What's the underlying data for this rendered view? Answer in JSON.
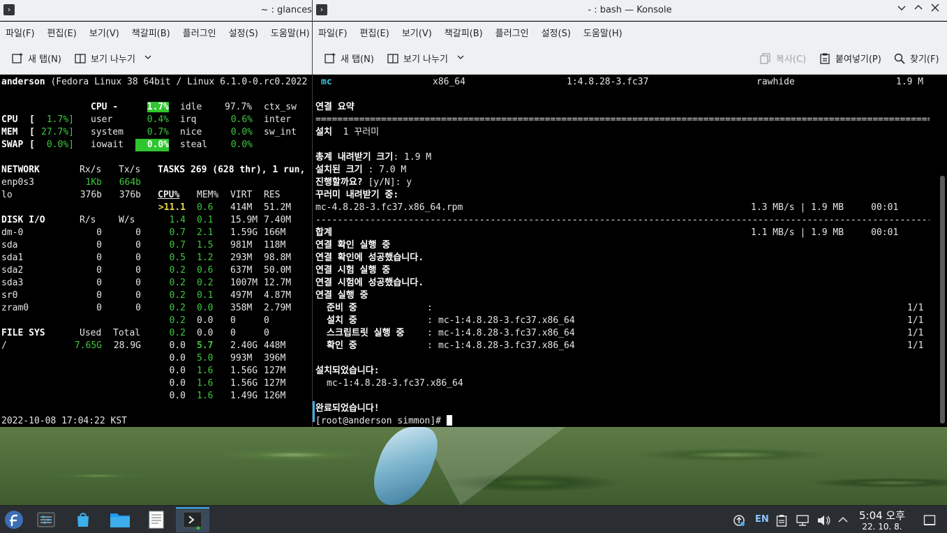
{
  "left_window": {
    "title": "~ : glances",
    "menu": [
      "파일(F)",
      "편집(E)",
      "보기(V)",
      "책갈피(B)",
      "플러그인",
      "설정(S)",
      "도움말(H)"
    ],
    "toolbar": {
      "new_tab": "새 탭(N)",
      "split_view": "보기 나누기"
    },
    "glances": {
      "header_host": "anderson",
      "header_rest": "(Fedora Linux 38 64bit / Linux 6.1.0-0.rc0.2022",
      "cpu_label": "CPU -",
      "cpu_total": "1.7%",
      "quick": [
        {
          "name": "CPU",
          "open": "[",
          "val": "1.7%]"
        },
        {
          "name": "MEM",
          "open": "[",
          "val": "27.7%]"
        },
        {
          "name": "SWAP",
          "open": "[",
          "val": "0.0%]"
        }
      ],
      "cpu_cols": [
        {
          "k1": "user",
          "v1": "0.4%",
          "k2": "irq",
          "v2": "0.6%",
          "k3": "inter"
        },
        {
          "k1": "system",
          "v1": "0.7%",
          "k2": "nice",
          "v2": "0.0%",
          "k3": "sw_int"
        },
        {
          "k1": "iowait",
          "v1": "0.0%",
          "k2": "steal",
          "v2": "0.0%",
          "k3": ""
        }
      ],
      "idle_label": "idle",
      "idle_val": "97.7%",
      "ctx_label": "ctx_sw",
      "network": {
        "title": "NETWORK",
        "rx": "Rx/s",
        "tx": "Tx/s",
        "rows": [
          {
            "name": "enp0s3",
            "rx": "1Kb",
            "tx": "664b"
          },
          {
            "name": "lo",
            "rx": "376b",
            "tx": "376b"
          }
        ]
      },
      "tasks": "TASKS 269 (628 thr), 1 run,",
      "proc_header": {
        "cpu": "CPU%",
        "mem": "MEM%",
        "virt": "VIRT",
        "res": "RES"
      },
      "procs": [
        {
          "cpu": ">11.1",
          "mem": "0.6",
          "virt": "414M",
          "res": "51.2M"
        },
        {
          "cpu": "1.4",
          "mem": "0.1",
          "virt": "15.9M",
          "res": "7.40M"
        },
        {
          "cpu": "0.7",
          "mem": "2.1",
          "virt": "1.59G",
          "res": "166M"
        },
        {
          "cpu": "0.7",
          "mem": "1.5",
          "virt": "981M",
          "res": "118M"
        },
        {
          "cpu": "0.5",
          "mem": "1.2",
          "virt": "293M",
          "res": "98.8M"
        },
        {
          "cpu": "0.2",
          "mem": "0.6",
          "virt": "637M",
          "res": "50.0M"
        },
        {
          "cpu": "0.2",
          "mem": "0.2",
          "virt": "1007M",
          "res": "12.7M"
        },
        {
          "cpu": "0.2",
          "mem": "0.1",
          "virt": "497M",
          "res": "4.87M"
        },
        {
          "cpu": "0.2",
          "mem": "0.0",
          "virt": "358M",
          "res": "2.79M"
        },
        {
          "cpu": "0.2",
          "mem": "0.0",
          "virt": "0",
          "res": "0"
        },
        {
          "cpu": "0.2",
          "mem": "0.0",
          "virt": "0",
          "res": "0"
        },
        {
          "cpu": "0.0",
          "mem": "5.7",
          "virt": "2.40G",
          "res": "448M"
        },
        {
          "cpu": "0.0",
          "mem": "5.0",
          "virt": "993M",
          "res": "396M"
        },
        {
          "cpu": "0.0",
          "mem": "1.6",
          "virt": "1.56G",
          "res": "127M"
        },
        {
          "cpu": "0.0",
          "mem": "1.6",
          "virt": "1.56G",
          "res": "127M"
        },
        {
          "cpu": "0.0",
          "mem": "1.6",
          "virt": "1.49G",
          "res": "126M"
        }
      ],
      "disk": {
        "title": "DISK I/O",
        "r": "R/s",
        "w": "W/s",
        "rows": [
          {
            "name": "dm-0",
            "r": "0",
            "w": "0"
          },
          {
            "name": "sda",
            "r": "0",
            "w": "0"
          },
          {
            "name": "sda1",
            "r": "0",
            "w": "0"
          },
          {
            "name": "sda2",
            "r": "0",
            "w": "0"
          },
          {
            "name": "sda3",
            "r": "0",
            "w": "0"
          },
          {
            "name": "sr0",
            "r": "0",
            "w": "0"
          },
          {
            "name": "zram0",
            "r": "0",
            "w": "0"
          }
        ]
      },
      "fs": {
        "title": "FILE SYS",
        "used": "Used",
        "total": "Total",
        "rows": [
          {
            "name": "/",
            "used": "7.65G",
            "total": "28.9G"
          }
        ]
      },
      "timestamp": "2022-10-08 17:04:22 KST"
    }
  },
  "right_window": {
    "title": "- : bash — Konsole",
    "menu": [
      "파일(F)",
      "편집(E)",
      "보기(V)",
      "책갈피(B)",
      "플러그인",
      "설정(S)",
      "도움말(H)"
    ],
    "toolbar": {
      "new_tab": "새 탭(N)",
      "split_view": "보기 나누기",
      "copy": "복사(C)",
      "paste": "붙여넣기(P)",
      "find": "찾기(F)"
    },
    "pkg_row": {
      "name": "mc",
      "arch": "x86_64",
      "version": "1:4.8.28-3.fc37",
      "repo": "rawhide",
      "size": "1.9 M"
    },
    "lines": {
      "summary": "연결 요약",
      "eq_rule": "==================================================================================================================",
      "install": "설치",
      "install_count": "1 꾸러미",
      "total_dl_label": "총계 내려받기 크기",
      "total_dl_val": ": 1.9 M",
      "installed_label": "설치된 크기",
      "installed_val": ": 7.0 M",
      "proceed_label": "진행할까요?",
      "proceed_val": " [y/N]: y",
      "downloading": "꾸러미 내려받기 중:",
      "rpm_file": "mc-4.8.28-3.fc37.x86_64.rpm",
      "rpm_stats": "1.3 MB/s | 1.9 MB     00:01",
      "dash_rule": "------------------------------------------------------------------------------------------------------------------",
      "total_label": "합계",
      "total_stats": "1.1 MB/s | 1.9 MB     00:01",
      "check_run": "연결 확인 실행 중",
      "check_ok": "연결 확인에 성공했습니다.",
      "test_run": "연결 시험 실행 중",
      "test_ok": "연결 시험에 성공했습니다.",
      "trans_run": "연결 실행 중",
      "steps": [
        {
          "label": "준비 중",
          "sep": ":",
          "pkg": "",
          "count": "1/1"
        },
        {
          "label": "설치 중",
          "sep": ":",
          "pkg": "mc-1:4.8.28-3.fc37.x86_64",
          "count": "1/1"
        },
        {
          "label": "스크립트릿 실행 중",
          "sep": ":",
          "pkg": "mc-1:4.8.28-3.fc37.x86_64",
          "count": "1/1"
        },
        {
          "label": "확인 중",
          "sep": ":",
          "pkg": "mc-1:4.8.28-3.fc37.x86_64",
          "count": "1/1"
        }
      ],
      "installed_hdr": "설치되었습니다:",
      "installed_pkg": "mc-1:4.8.28-3.fc37.x86_64",
      "done": "완료되었습니다!",
      "prompt": "[root@anderson simmon]# "
    }
  },
  "taskbar": {
    "apps": [
      "fedora-launcher-icon",
      "system-settings-icon",
      "discover-icon",
      "file-manager-icon",
      "text-editor-icon",
      "konsole-icon"
    ],
    "lang": "EN",
    "time": "5:04 오후",
    "date": "22. 10. 8."
  }
}
